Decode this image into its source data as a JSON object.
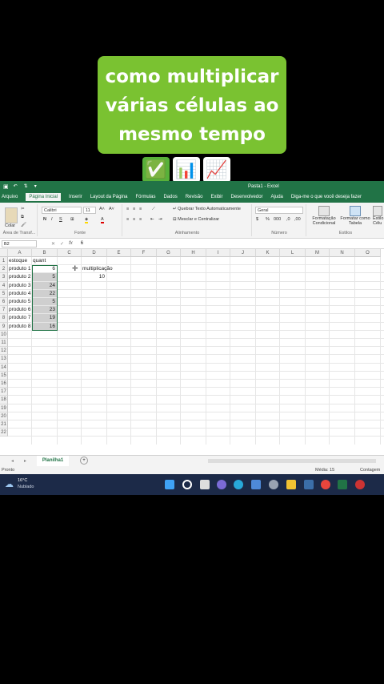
{
  "overlay": {
    "line1": "como multiplicar",
    "line2": "várias células ao",
    "line3": "mesmo tempo",
    "emoji_check": "✅",
    "emoji_bar": "📊",
    "emoji_trend": "📈"
  },
  "window": {
    "title": "Pasta1 - Excel"
  },
  "tabs": [
    "Arquivo",
    "Página Inicial",
    "Inserir",
    "Layout da Página",
    "Fórmulas",
    "Dados",
    "Revisão",
    "Exibir",
    "Desenvolvedor",
    "Ajuda",
    "Diga-me o que você deseja fazer"
  ],
  "ribbon": {
    "paste": "Colar",
    "clipboard": "Área de Transf...",
    "font_name": "Calibri",
    "font_size": "11",
    "font_group": "Fonte",
    "wrap_text": "Quebrar Texto Automaticamente",
    "merge_center": "Mesclar e Centralizar",
    "align_group": "Alinhamento",
    "number_format": "Geral",
    "number_group": "Número",
    "cond_format": "Formatação Condicional",
    "format_table": "Formatar como Tabela",
    "cell_styles": "Estilo Célu",
    "styles_group": "Estilos"
  },
  "formula_bar": {
    "name_box": "B2",
    "fx": "fx",
    "value": "6"
  },
  "columns": [
    "A",
    "B",
    "C",
    "D",
    "E",
    "F",
    "G",
    "H",
    "I",
    "J",
    "K",
    "L",
    "M",
    "N",
    "O"
  ],
  "rows": [
    "1",
    "2",
    "3",
    "4",
    "5",
    "6",
    "7",
    "8",
    "9",
    "10",
    "11",
    "12",
    "13",
    "14",
    "15",
    "16",
    "17",
    "18",
    "19",
    "20",
    "21",
    "22"
  ],
  "cells": {
    "a": [
      "estoque",
      "produto 1",
      "produto 2",
      "produto 3",
      "produto 4",
      "produto 5",
      "produto 6",
      "produto 7",
      "produto 8"
    ],
    "b_header": "quant",
    "b": [
      "6",
      "5",
      "24",
      "22",
      "5",
      "23",
      "19",
      "16"
    ],
    "d1": "multiplicação",
    "d2": "10"
  },
  "sheet": {
    "name": "Planilha1",
    "add": "+"
  },
  "status": {
    "left": "Pronto",
    "avg": "Média: 15",
    "count": "Contagem"
  },
  "taskbar": {
    "temp": "16°C",
    "weather": "Nublado"
  }
}
